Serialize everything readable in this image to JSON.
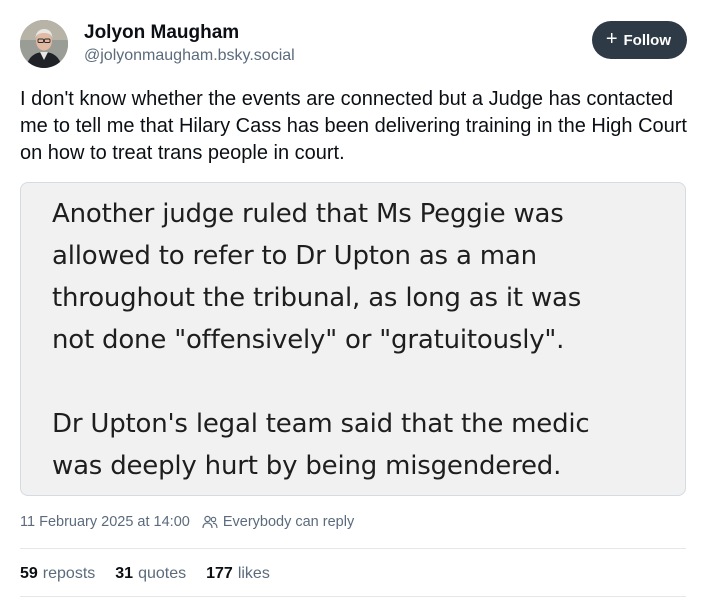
{
  "author": {
    "name": "Jolyon Maugham",
    "handle": "@jolyonmaugham.bsky.social",
    "avatar_icon": "person-portrait-icon"
  },
  "follow_button": {
    "icon": "plus-icon",
    "icon_glyph": "+",
    "label": "Follow"
  },
  "post": {
    "text": "I don't know whether the events are connected but a Judge has contacted me to tell me that Hilary Cass has been delivering training in the High Court on how to treat trans people in court."
  },
  "embedded_image": {
    "paragraph_1_lines": [
      "Another judge ruled that Ms Peggie was",
      "allowed to refer to Dr Upton as a man",
      "throughout the tribunal, as long as it was",
      "not done \"offensively\" or \"gratuitously\"."
    ],
    "paragraph_2_lines": [
      "Dr Upton's legal team said that the medic",
      "was deeply hurt by being misgendered."
    ]
  },
  "meta": {
    "timestamp": "11 February 2025 at 14:00",
    "reply_icon": "people-icon",
    "reply_setting": "Everybody can reply"
  },
  "stats": {
    "reposts_count": "59",
    "reposts_label": "reposts",
    "quotes_count": "31",
    "quotes_label": "quotes",
    "likes_count": "177",
    "likes_label": "likes"
  },
  "colors": {
    "text_primary": "#0b0f14",
    "text_secondary": "#5b6b7c",
    "follow_button_bg": "#2e3a46",
    "quote_bg": "#f1f1f1",
    "border": "#d4dbe2"
  }
}
